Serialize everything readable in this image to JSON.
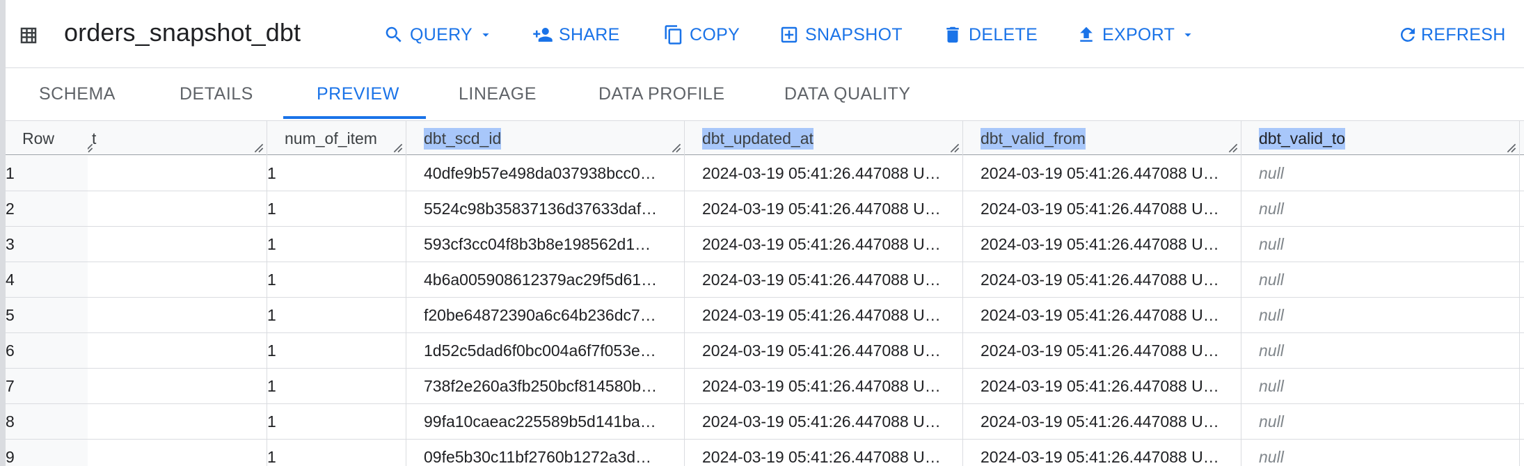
{
  "header": {
    "title": "orders_snapshot_dbt",
    "buttons": {
      "query": "QUERY",
      "share": "SHARE",
      "copy": "COPY",
      "snapshot": "SNAPSHOT",
      "delete": "DELETE",
      "export": "EXPORT",
      "refresh": "REFRESH"
    }
  },
  "tabs": {
    "schema": "SCHEMA",
    "details": "DETAILS",
    "preview": "PREVIEW",
    "lineage": "LINEAGE",
    "data_profile": "DATA PROFILE",
    "data_quality": "DATA QUALITY",
    "active": "PREVIEW"
  },
  "table": {
    "headers": {
      "row": "Row",
      "partial": "t",
      "num_of_item": "num_of_item",
      "dbt_scd_id": "dbt_scd_id",
      "dbt_updated_at": "dbt_updated_at",
      "dbt_valid_from": "dbt_valid_from",
      "dbt_valid_to": "dbt_valid_to"
    },
    "rows": [
      {
        "row": "1",
        "num_of_item": "1",
        "dbt_scd_id": "40dfe9b57e498da037938bcc0…",
        "dbt_updated_at": "2024-03-19 05:41:26.447088 U…",
        "dbt_valid_from": "2024-03-19 05:41:26.447088 U…",
        "dbt_valid_to": "null"
      },
      {
        "row": "2",
        "num_of_item": "1",
        "dbt_scd_id": "5524c98b35837136d37633daf…",
        "dbt_updated_at": "2024-03-19 05:41:26.447088 U…",
        "dbt_valid_from": "2024-03-19 05:41:26.447088 U…",
        "dbt_valid_to": "null"
      },
      {
        "row": "3",
        "num_of_item": "1",
        "dbt_scd_id": "593cf3cc04f8b3b8e198562d1…",
        "dbt_updated_at": "2024-03-19 05:41:26.447088 U…",
        "dbt_valid_from": "2024-03-19 05:41:26.447088 U…",
        "dbt_valid_to": "null"
      },
      {
        "row": "4",
        "num_of_item": "1",
        "dbt_scd_id": "4b6a005908612379ac29f5d61…",
        "dbt_updated_at": "2024-03-19 05:41:26.447088 U…",
        "dbt_valid_from": "2024-03-19 05:41:26.447088 U…",
        "dbt_valid_to": "null"
      },
      {
        "row": "5",
        "num_of_item": "1",
        "dbt_scd_id": "f20be64872390a6c64b236dc7…",
        "dbt_updated_at": "2024-03-19 05:41:26.447088 U…",
        "dbt_valid_from": "2024-03-19 05:41:26.447088 U…",
        "dbt_valid_to": "null"
      },
      {
        "row": "6",
        "num_of_item": "1",
        "dbt_scd_id": "1d52c5dad6f0bc004a6f7f053e…",
        "dbt_updated_at": "2024-03-19 05:41:26.447088 U…",
        "dbt_valid_from": "2024-03-19 05:41:26.447088 U…",
        "dbt_valid_to": "null"
      },
      {
        "row": "7",
        "num_of_item": "1",
        "dbt_scd_id": "738f2e260a3fb250bcf814580b…",
        "dbt_updated_at": "2024-03-19 05:41:26.447088 U…",
        "dbt_valid_from": "2024-03-19 05:41:26.447088 U…",
        "dbt_valid_to": "null"
      },
      {
        "row": "8",
        "num_of_item": "1",
        "dbt_scd_id": "99fa10caeac225589b5d141ba…",
        "dbt_updated_at": "2024-03-19 05:41:26.447088 U…",
        "dbt_valid_from": "2024-03-19 05:41:26.447088 U…",
        "dbt_valid_to": "null"
      },
      {
        "row": "9",
        "num_of_item": "1",
        "dbt_scd_id": "09fe5b30c11bf2760b1272a3d…",
        "dbt_updated_at": "2024-03-19 05:41:26.447088 U…",
        "dbt_valid_from": "2024-03-19 05:41:26.447088 U…",
        "dbt_valid_to": "null"
      }
    ]
  },
  "colors": {
    "accent": "#1a73e8",
    "selection": "#a8c7fa",
    "border": "#dadce0",
    "null_text": "#80868b"
  }
}
